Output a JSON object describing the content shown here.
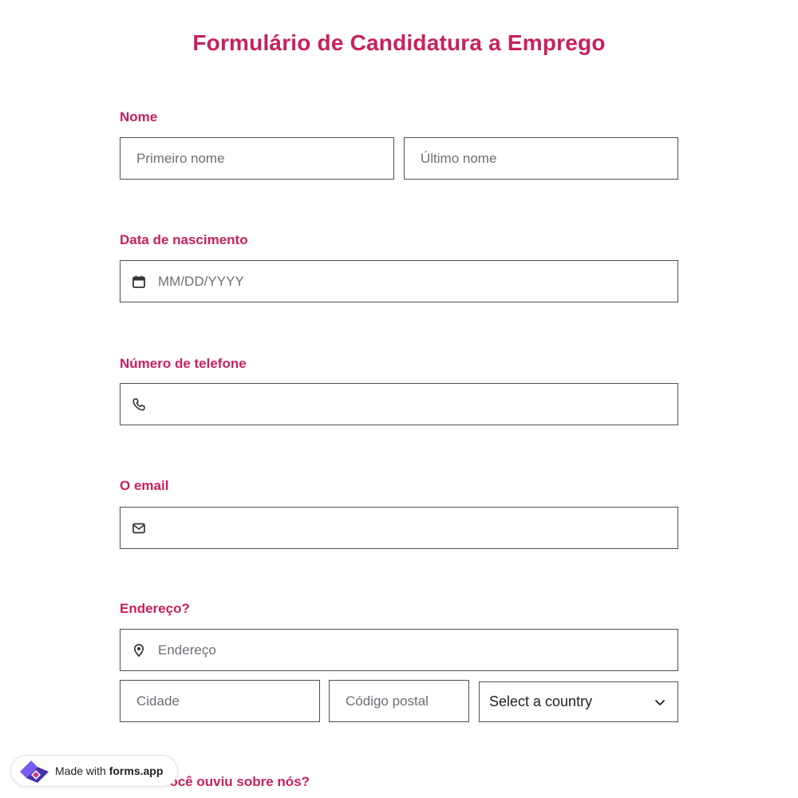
{
  "form": {
    "title": "Formulário de Candidatura a Emprego",
    "accent_color": "#c8205e"
  },
  "name": {
    "label": "Nome",
    "first_placeholder": "Primeiro nome",
    "last_placeholder": "Último nome"
  },
  "birth": {
    "label": "Data de nascimento",
    "placeholder": "MM/DD/YYYY",
    "icon": "calendar-icon"
  },
  "phone": {
    "label": "Número de telefone",
    "placeholder": "",
    "icon": "phone-icon"
  },
  "email": {
    "label": "O email",
    "placeholder": "",
    "icon": "mail-icon"
  },
  "address": {
    "label": "Endereço?",
    "street_placeholder": "Endereço",
    "city_placeholder": "Cidade",
    "postal_placeholder": "Código postal",
    "country_selected": "Select a country",
    "icon": "location-pin-icon"
  },
  "next_question": {
    "label": "Como você ouviu sobre nós?"
  },
  "badge": {
    "prefix": "Made with",
    "brand": "forms.app"
  }
}
